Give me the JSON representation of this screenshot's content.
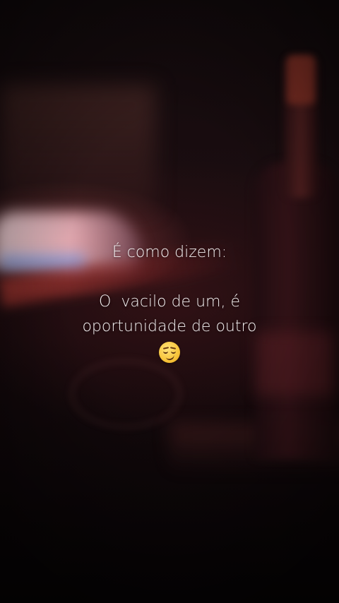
{
  "caption": {
    "line1": "É como dizem:",
    "line2": "O  vacilo de um, é",
    "line3": "oportunidade de outro",
    "emoji": "smirking-face"
  }
}
